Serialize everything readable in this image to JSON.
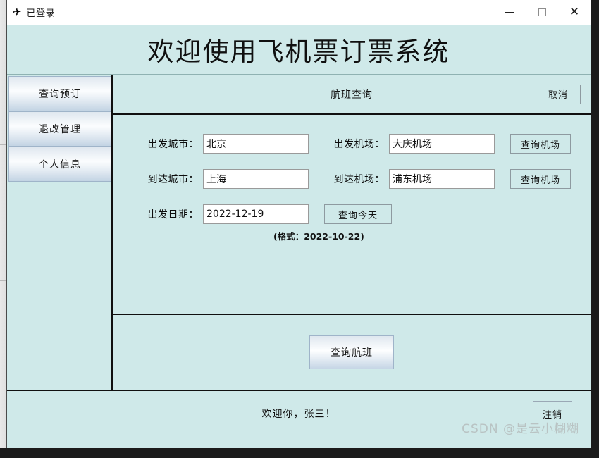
{
  "window": {
    "title": "已登录",
    "icon": "airplane-icon",
    "controls": {
      "minimize": "−",
      "maximize": "□",
      "close": "✕"
    }
  },
  "banner": {
    "heading": "欢迎使用飞机票订票系统"
  },
  "sidebar": {
    "items": [
      {
        "label": "查询预订"
      },
      {
        "label": "退改管理"
      },
      {
        "label": "个人信息"
      }
    ]
  },
  "panel": {
    "title": "航班查询",
    "cancel_label": "取消"
  },
  "form": {
    "departure_city": {
      "label": "出发城市：",
      "value": "北京",
      "placeholder": ""
    },
    "departure_airport": {
      "label": "出发机场：",
      "value": "大庆机场",
      "placeholder": "",
      "lookup_label": "查询机场"
    },
    "arrival_city": {
      "label": "到达城市：",
      "value": "上海",
      "placeholder": ""
    },
    "arrival_airport": {
      "label": "到达机场：",
      "value": "浦东机场",
      "placeholder": "",
      "lookup_label": "查询机场"
    },
    "departure_date": {
      "label": "出发日期：",
      "value": "2022-12-19",
      "placeholder": "",
      "today_label": "查询今天",
      "format_hint": "(格式：2022-10-22)"
    }
  },
  "actions": {
    "search_flight_label": "查询航班"
  },
  "footer": {
    "welcome_text": "欢迎你，张三！",
    "logout_label": "注销"
  },
  "watermark": {
    "text": "CSDN @是云小糊糊"
  },
  "colors": {
    "panel_bg": "#cfe9e9",
    "titlebar_bg": "#ffffff",
    "border_dark": "#101010",
    "input_bg": "#ffffff",
    "button_border": "#8e9aa0"
  }
}
